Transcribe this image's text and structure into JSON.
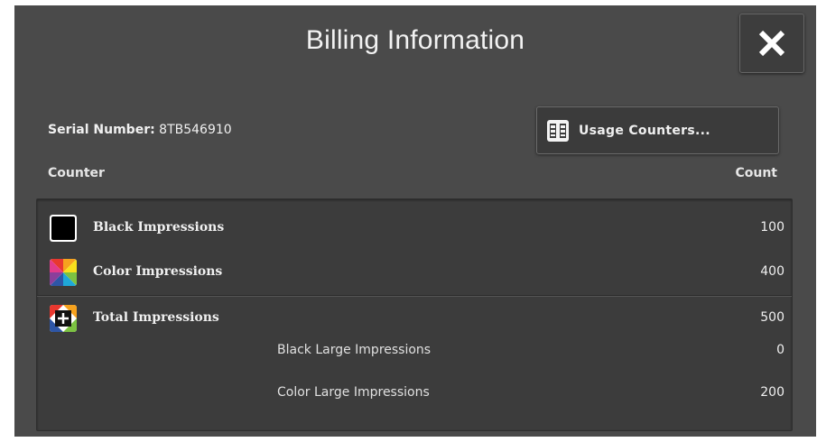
{
  "dialog": {
    "title": "Billing Information",
    "close_icon": "close-icon"
  },
  "serial": {
    "label": "Serial Number:",
    "value": "8TB546910"
  },
  "usage_counters_button": {
    "label": "Usage Counters...",
    "icon": "usage-counters-icon"
  },
  "columns": {
    "counter": "Counter",
    "count": "Count"
  },
  "rows": [
    {
      "label": "Black Impressions",
      "value": "100",
      "icon": "black-swatch-icon"
    },
    {
      "label": "Color Impressions",
      "value": "400",
      "icon": "color-swatch-icon"
    },
    {
      "label": "Total Impressions",
      "value": "500",
      "icon": "total-swatch-icon"
    },
    {
      "label": "Black Large Impressions",
      "value": "0"
    },
    {
      "label": "Color Large Impressions",
      "value": "200"
    }
  ],
  "colors": {
    "dialog_bg": "#4a4a4a",
    "table_bg": "#3c3c3c",
    "text": "#f0f0f0"
  }
}
